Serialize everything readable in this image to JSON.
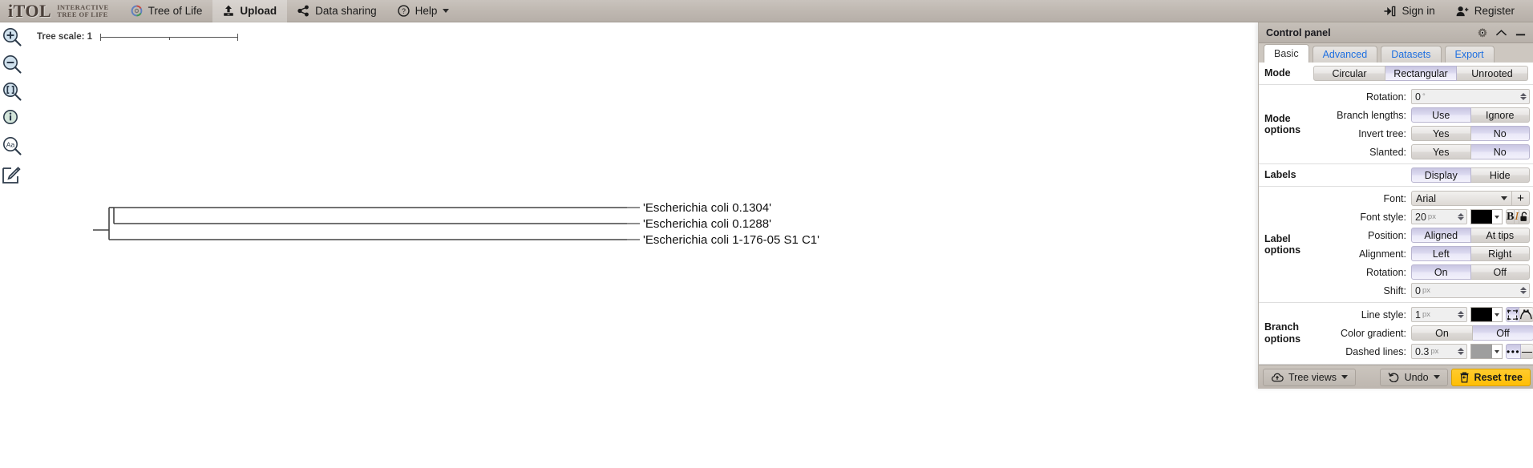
{
  "app": {
    "logo_main": "iTOL",
    "logo_line1": "Interactive",
    "logo_line2": "Tree Of Life"
  },
  "topnav": {
    "items": [
      {
        "label": "Tree of Life",
        "icon": "circular-tree-icon",
        "active": false
      },
      {
        "label": "Upload",
        "icon": "upload-icon",
        "active": true
      },
      {
        "label": "Data sharing",
        "icon": "share-nodes-icon",
        "active": false
      },
      {
        "label": "Help",
        "icon": "question-circle-icon",
        "active": false,
        "has_caret": true
      }
    ],
    "right": [
      {
        "label": "Sign in",
        "icon": "sign-in-icon"
      },
      {
        "label": "Register",
        "icon": "user-plus-icon"
      }
    ]
  },
  "lefttoolbar": {
    "items": [
      {
        "name": "zoom-in-icon",
        "title": "Zoom in"
      },
      {
        "name": "zoom-out-icon",
        "title": "Zoom out"
      },
      {
        "name": "zoom-fit-icon",
        "title": "Fit to screen"
      },
      {
        "name": "info-icon",
        "title": "Information"
      },
      {
        "name": "search-text-icon",
        "title": "Find text"
      },
      {
        "name": "edit-icon",
        "title": "Edit / annotate"
      }
    ]
  },
  "canvas": {
    "scale_label": "Tree scale: 1",
    "leaf_labels": [
      "'Escherichia coli 0.1304'",
      "'Escherichia coli 0.1288'",
      "'Escherichia coli 1-176-05 S1 C1'"
    ]
  },
  "control_panel": {
    "title": "Control panel",
    "header_icons": [
      "gear-icon",
      "chevron-up-icon",
      "minimize-icon"
    ],
    "tabs": [
      {
        "label": "Basic",
        "active": true
      },
      {
        "label": "Advanced",
        "active": false
      },
      {
        "label": "Datasets",
        "active": false
      },
      {
        "label": "Export",
        "active": false
      }
    ],
    "sections": {
      "mode": {
        "label": "Mode",
        "options": [
          "Circular",
          "Rectangular",
          "Unrooted"
        ],
        "selected": "Rectangular"
      },
      "mode_options": {
        "label_line1": "Mode",
        "label_line2": "options",
        "rotation": {
          "label": "Rotation:",
          "value": "0",
          "unit": "°"
        },
        "branch_lengths": {
          "label": "Branch lengths:",
          "options": [
            "Use",
            "Ignore"
          ],
          "selected": "Use"
        },
        "invert_tree": {
          "label": "Invert tree:",
          "options": [
            "Yes",
            "No"
          ],
          "selected": "No"
        },
        "slanted": {
          "label": "Slanted:",
          "options": [
            "Yes",
            "No"
          ],
          "selected": "No"
        }
      },
      "labels": {
        "label": "Labels",
        "options": [
          "Display",
          "Hide"
        ],
        "selected": "Display"
      },
      "label_options": {
        "label_line1": "Label",
        "label_line2": "options",
        "font": {
          "label": "Font:",
          "value": "Arial",
          "add_label": "+"
        },
        "font_style": {
          "label": "Font style:",
          "size": "20",
          "unit": "px",
          "color": "#000000",
          "bold_label": "B",
          "italic_label": "I",
          "lock_icon": "lock-open-icon"
        },
        "position": {
          "label": "Position:",
          "options": [
            "Aligned",
            "At tips"
          ],
          "selected": "Aligned"
        },
        "alignment": {
          "label": "Alignment:",
          "options": [
            "Left",
            "Right"
          ],
          "selected": "Left"
        },
        "rotation": {
          "label": "Rotation:",
          "options": [
            "On",
            "Off"
          ],
          "selected": "On"
        },
        "shift": {
          "label": "Shift:",
          "value": "0",
          "unit": "px"
        }
      },
      "branch_options": {
        "label_line1": "Branch",
        "label_line2": "options",
        "line_style": {
          "label": "Line style:",
          "width": "1",
          "unit": "px",
          "color": "#000000",
          "cap_icon": "square-cap-icon",
          "join_icon": "bezier-node-icon",
          "selected_icon": "square-cap-icon"
        },
        "color_gradient": {
          "label": "Color gradient:",
          "options": [
            "On",
            "Off"
          ],
          "selected": "Off"
        },
        "dashed_lines": {
          "label": "Dashed lines:",
          "width": "0.3",
          "unit": "px",
          "color": "#9e9e9e",
          "dotted_label": "•••",
          "solid_label": "—",
          "selected": "dotted"
        }
      }
    },
    "footer": {
      "tree_views": {
        "label": "Tree views",
        "icon": "cloud-upload-icon"
      },
      "undo": {
        "label": "Undo",
        "icon": "undo-icon"
      },
      "reset": {
        "label": "Reset tree",
        "icon": "trash-restore-icon"
      }
    }
  },
  "colors": {
    "accent_yellow": "#ffbe05",
    "tab_link_blue": "#1e6fe0",
    "selected_lavender": "#dcdaf0",
    "chrome_grey": "#bfb8b1"
  }
}
